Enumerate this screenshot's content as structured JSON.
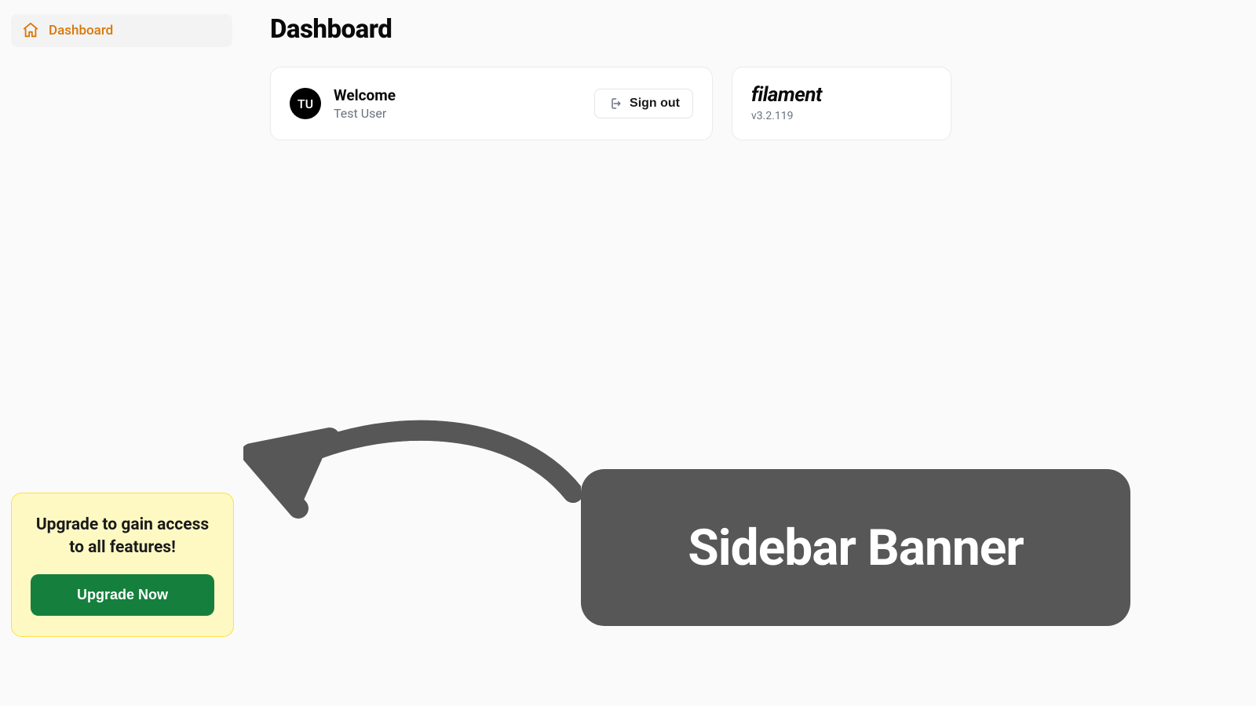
{
  "sidebar": {
    "items": [
      {
        "label": "Dashboard"
      }
    ]
  },
  "page": {
    "title": "Dashboard"
  },
  "welcome": {
    "avatar_initials": "TU",
    "title": "Welcome",
    "user_name": "Test User",
    "signout_label": "Sign out"
  },
  "filament": {
    "logo_text": "filament",
    "version": "v3.2.119"
  },
  "upgrade": {
    "title": "Upgrade to gain access to all features!",
    "button_label": "Upgrade Now"
  },
  "annotation": {
    "label": "Sidebar Banner"
  }
}
